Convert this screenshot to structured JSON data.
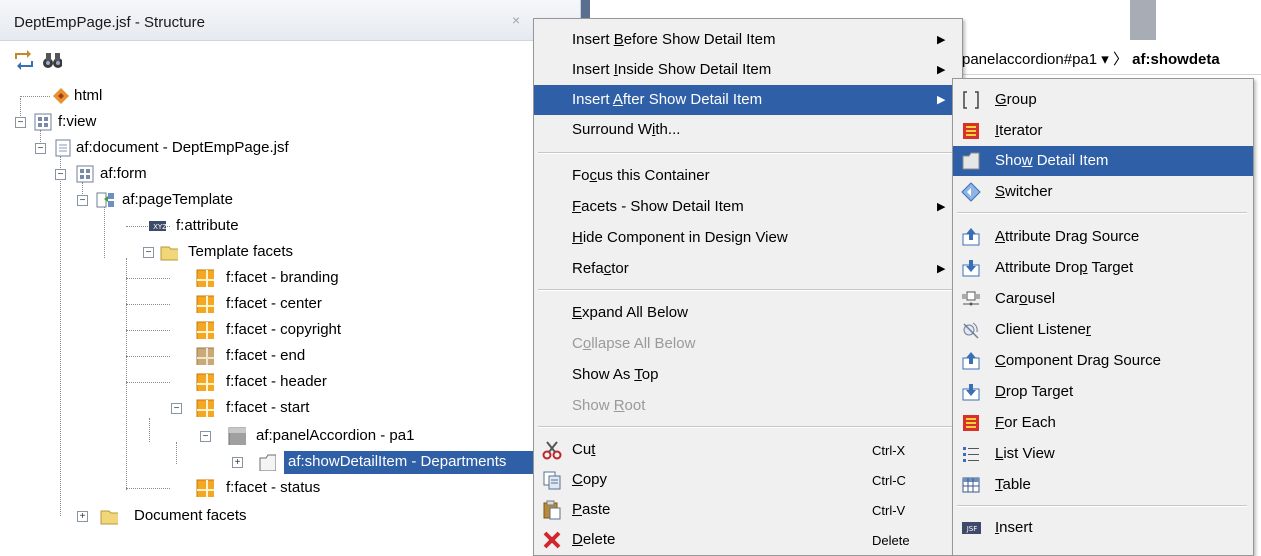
{
  "structure": {
    "title": "DeptEmpPage.jsf - Structure",
    "close": "×",
    "tree": [
      {
        "label": "html"
      },
      {
        "label": "f:view"
      },
      {
        "label": "af:document - DeptEmpPage.jsf"
      },
      {
        "label": "af:form"
      },
      {
        "label": "af:pageTemplate"
      },
      {
        "label": "f:attribute"
      },
      {
        "label": "Template facets"
      },
      {
        "label": "f:facet - branding"
      },
      {
        "label": "f:facet - center"
      },
      {
        "label": "f:facet - copyright"
      },
      {
        "label": "f:facet - end"
      },
      {
        "label": "f:facet - header"
      },
      {
        "label": "f:facet - start"
      },
      {
        "label": "af:panelAccordion - pa1"
      },
      {
        "label": "af:showDetailItem - Departments",
        "selected": true
      },
      {
        "label": "f:facet - status"
      },
      {
        "label": "Document facets"
      }
    ]
  },
  "breadcrumb": {
    "item": "panelaccordion#pa1 ▾",
    "sep": "〉",
    "current": "af:showdeta"
  },
  "context_menu": {
    "items": [
      {
        "pre": "Insert ",
        "u": "B",
        "post": "efore Show Detail Item",
        "arrow": "▶"
      },
      {
        "pre": "Insert ",
        "u": "I",
        "post": "nside Show Detail Item",
        "arrow": "▶"
      },
      {
        "pre": "Insert ",
        "u": "A",
        "post": "fter Show Detail Item",
        "arrow": "▶",
        "highlighted": true
      },
      {
        "pre": "Surround W",
        "u": "i",
        "post": "th..."
      },
      {
        "pre": "Fo",
        "u": "c",
        "post": "us this Container"
      },
      {
        "pre": "",
        "u": "F",
        "post": "acets - Show Detail Item",
        "arrow": "▶"
      },
      {
        "pre": "",
        "u": "H",
        "post": "ide Component in Design View"
      },
      {
        "pre": "Refa",
        "u": "c",
        "post": "tor",
        "arrow": "▶"
      },
      {
        "pre": "",
        "u": "E",
        "post": "xpand All Below"
      },
      {
        "pre": "C",
        "u": "o",
        "post": "llapse All Below",
        "disabled": true
      },
      {
        "pre": "Show As ",
        "u": "T",
        "post": "op"
      },
      {
        "pre": "Show ",
        "u": "R",
        "post": "oot",
        "disabled": true
      },
      {
        "pre": "Cu",
        "u": "t",
        "post": "",
        "shortcut": "Ctrl-X",
        "icon": "scissors-icon"
      },
      {
        "pre": "",
        "u": "C",
        "post": "opy",
        "shortcut": "Ctrl-C",
        "icon": "copy-icon"
      },
      {
        "pre": "",
        "u": "P",
        "post": "aste",
        "shortcut": "Ctrl-V",
        "icon": "paste-icon"
      },
      {
        "pre": "",
        "u": "D",
        "post": "elete",
        "shortcut": "Delete",
        "icon": "delete-icon"
      }
    ]
  },
  "submenu": {
    "items": [
      {
        "pre": "",
        "u": "G",
        "post": "roup",
        "icon": "group-icon"
      },
      {
        "pre": "",
        "u": "I",
        "post": "terator",
        "icon": "iterator-icon"
      },
      {
        "pre": "Sho",
        "u": "w",
        "post": " Detail Item",
        "icon": "show-detail-item-icon",
        "highlighted": true
      },
      {
        "pre": "",
        "u": "S",
        "post": "witcher",
        "icon": "switcher-icon"
      },
      {
        "pre": "",
        "u": "A",
        "post": "ttribute Drag Source",
        "icon": "drag-source-icon"
      },
      {
        "pre": "Attribute Dro",
        "u": "p",
        "post": " Target",
        "icon": "drop-target-icon"
      },
      {
        "pre": "Car",
        "u": "o",
        "post": "usel",
        "icon": "carousel-icon"
      },
      {
        "pre": "Client Listene",
        "u": "r",
        "post": "",
        "icon": "client-listener-icon"
      },
      {
        "pre": "",
        "u": "C",
        "post": "omponent Drag Source",
        "icon": "drag-source-icon"
      },
      {
        "pre": "",
        "u": "D",
        "post": "rop Target",
        "icon": "drop-target-icon"
      },
      {
        "pre": "",
        "u": "F",
        "post": "or Each",
        "icon": "for-each-icon"
      },
      {
        "pre": "",
        "u": "L",
        "post": "ist View",
        "icon": "list-view-icon"
      },
      {
        "pre": "",
        "u": "T",
        "post": "able",
        "icon": "table-icon"
      },
      {
        "pre": "",
        "u": "I",
        "post": "nsert",
        "icon": "jsf-insert-icon"
      }
    ]
  },
  "colors": {
    "highlight": "#2f5fa6",
    "menu_bg": "#f0f0f0"
  }
}
